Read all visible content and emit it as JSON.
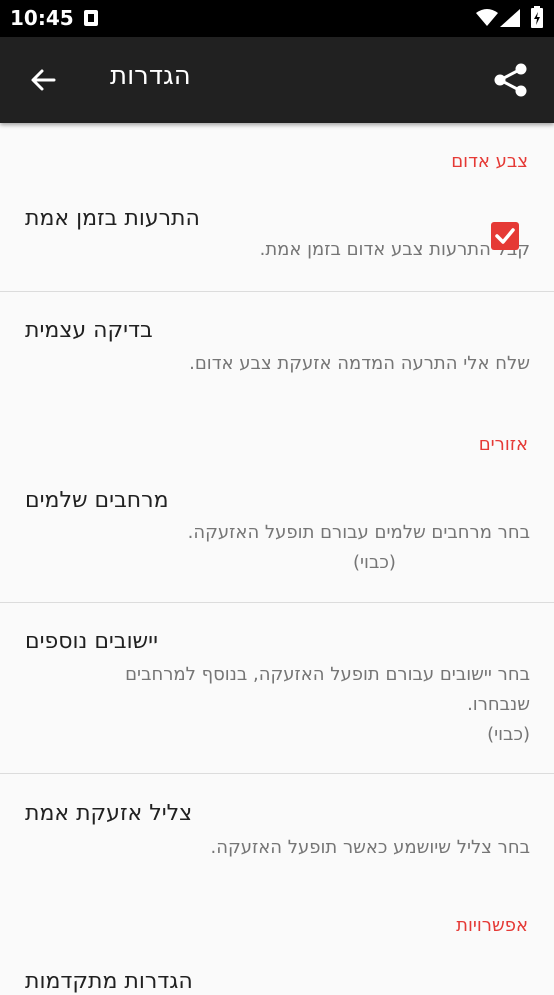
{
  "status": {
    "time": "10:45"
  },
  "appbar": {
    "title": "הגדרות"
  },
  "sections": {
    "red_color": "צבע אדום",
    "zones": "אזורים",
    "options": "אפשרויות"
  },
  "prefs": {
    "realtime": {
      "title": "התרעות בזמן אמת",
      "summary": "קבל התרעות צבע אדום בזמן אמת.",
      "checked": true
    },
    "selftest": {
      "title": "בדיקה עצמית",
      "summary": "שלח אלי התרעה המדמה אזעקת צבע אדום."
    },
    "areas": {
      "title": "מרחבים שלמים",
      "summary_l1": "בחר מרחבים שלמים עבורם תופעל האזעקה.",
      "summary_l2": "(כבוי)"
    },
    "cities": {
      "title": "יישובים נוספים",
      "summary_l1": "בחר יישובים עבורם תופעל האזעקה, בנוסף למרחבים",
      "summary_l2": "שנבחרו.",
      "summary_l3": "(כבוי)"
    },
    "sound": {
      "title": "צליל אזעקת אמת",
      "summary": "בחר צליל שיושמע כאשר תופעל האזעקה."
    },
    "advanced": {
      "title": "הגדרות מתקדמות"
    }
  },
  "colors": {
    "accent": "#e53935",
    "appbar": "#212121"
  }
}
